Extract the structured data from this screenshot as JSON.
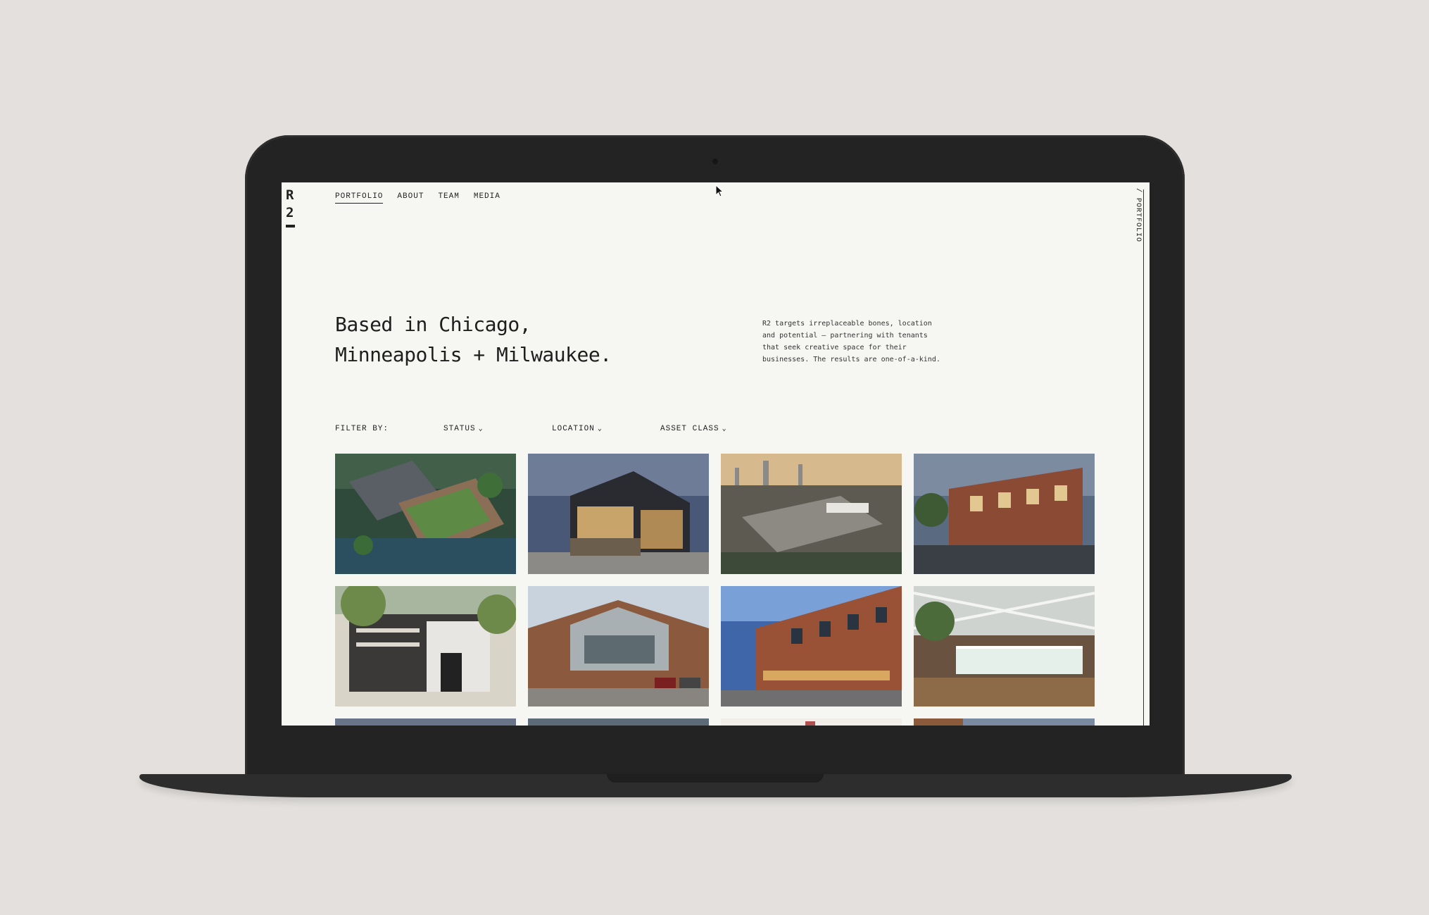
{
  "logo": {
    "chars": [
      "R",
      "2"
    ]
  },
  "nav": {
    "items": [
      {
        "label": "PORTFOLIO",
        "active": true
      },
      {
        "label": "ABOUT",
        "active": false
      },
      {
        "label": "TEAM",
        "active": false
      },
      {
        "label": "MEDIA",
        "active": false
      }
    ]
  },
  "side_label": "/ PORTFOLIO",
  "hero": {
    "headline_lines": [
      "Based in Chicago,",
      "Minneapolis + Milwaukee."
    ],
    "intro_lines": [
      "R2 targets irreplaceable bones, location",
      "and potential – partnering with tenants",
      "that seek creative space for their",
      "businesses. The results are one-of-a-kind."
    ]
  },
  "filters": {
    "label": "FILTER BY:",
    "items": [
      {
        "label": "STATUS",
        "icon": "chevron-down-icon"
      },
      {
        "label": "LOCATION",
        "icon": "chevron-down-icon"
      },
      {
        "label": "ASSET CLASS",
        "icon": "chevron-down-icon"
      }
    ]
  },
  "colors": {
    "background": "#e3e0dd",
    "laptop_body": "#232323",
    "screen": "#f6f6f3",
    "text": "#1e1e1e"
  }
}
